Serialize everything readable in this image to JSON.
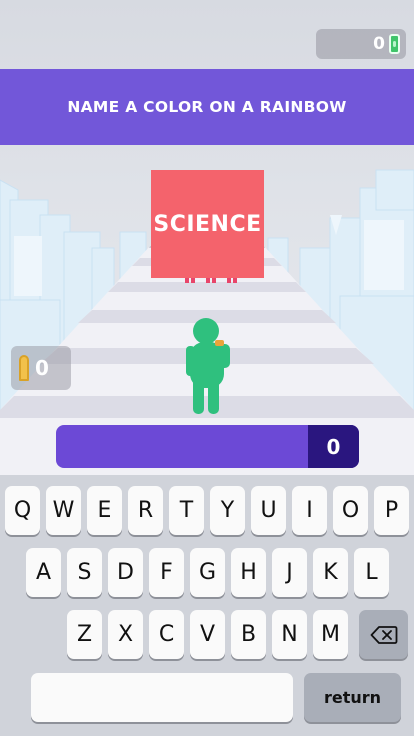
{
  "hud": {
    "money_count": "0",
    "money_icon": "cash-icon",
    "ammo_count": "0",
    "ammo_icon": "bullet-icon"
  },
  "question": "NAME A COLOR ON A RAINBOW",
  "gate": {
    "label": "SCIENCE",
    "color": "#f4636c"
  },
  "answer": {
    "value": "",
    "score": "0"
  },
  "colors": {
    "banner": "#7257d9",
    "answer_bar": "#6c49d6",
    "score_box": "#2a167f",
    "player": "#2fc07e",
    "enemies": "#e8456a"
  },
  "keyboard": {
    "row1": [
      "Q",
      "W",
      "E",
      "R",
      "T",
      "Y",
      "U",
      "I",
      "O",
      "P"
    ],
    "row2": [
      "A",
      "S",
      "D",
      "F",
      "G",
      "H",
      "J",
      "K",
      "L"
    ],
    "row3": [
      "Z",
      "X",
      "C",
      "V",
      "B",
      "N",
      "M"
    ],
    "backspace_icon": "backspace-icon",
    "return_label": "return"
  }
}
